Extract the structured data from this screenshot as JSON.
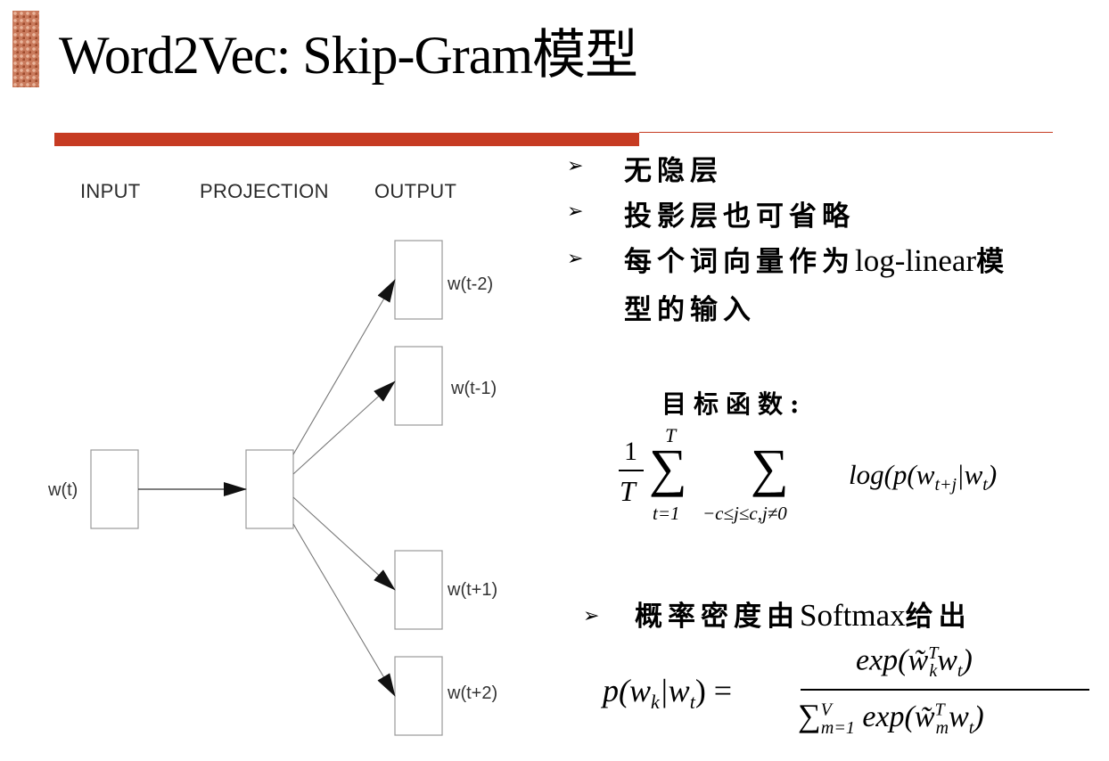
{
  "slide": {
    "title": "Word2Vec: Skip-Gram模型"
  },
  "diagram": {
    "columns": [
      "INPUT",
      "PROJECTION",
      "OUTPUT"
    ],
    "input_node": "w(t)",
    "output_nodes": [
      "w(t-2)",
      "w(t-1)",
      "w(t+1)",
      "w(t+2)"
    ]
  },
  "bullets": {
    "marker": "➢",
    "items": [
      {
        "cjk": "无隐层",
        "latin": ""
      },
      {
        "cjk": "投影层也可省略",
        "latin": ""
      },
      {
        "cjk_a": "每个词向量作为",
        "latin": "log-linear",
        "cjk_b": "模",
        "line2": "型的输入"
      }
    ]
  },
  "objective": {
    "label": "目标函数:",
    "frac_num": "1",
    "frac_den": "T",
    "sum1_upper": "T",
    "sum1_lower": "t=1",
    "sum2_lower": "−c≤j≤c,j≠0",
    "term": "log(p(w",
    "term_sub": "t+j",
    "term_mid": "|w",
    "term_sub2": "t",
    "term_end": ")"
  },
  "softmax": {
    "marker": "➢",
    "cjk_a": "概率密度由",
    "latin": "Softmax",
    "cjk_b": "给出",
    "lhs": "p(w",
    "lhs_sub": "k",
    "lhs_mid": "|w",
    "lhs_sub2": "t",
    "lhs_end": ") =",
    "num": "exp(w̃",
    "num_sup": "T",
    "num_sub": "k",
    "num_rest": "w",
    "num_rest_sub": "t",
    "num_end": ")",
    "den_sigma": "∑",
    "den_upper": "V",
    "den_lower": "m=1",
    "den": "exp(w̃",
    "den_sup": "T",
    "den_sub": "m",
    "den_rest": "w",
    "den_rest_sub": "t",
    "den_end": ")"
  }
}
